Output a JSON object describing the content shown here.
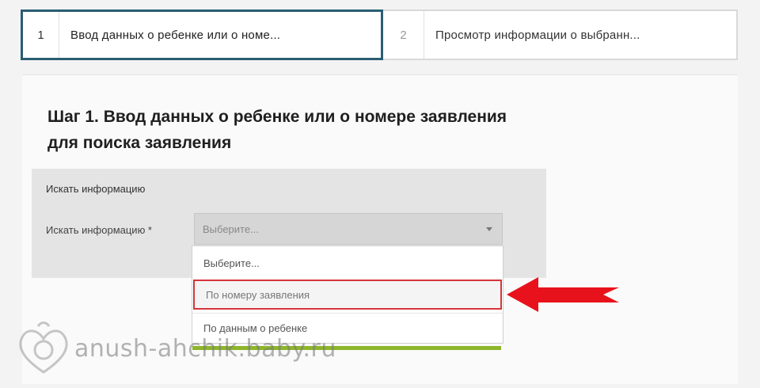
{
  "stepper": {
    "steps": [
      {
        "number": "1",
        "label": "Ввод данных о ребенке или о номе...",
        "active": true
      },
      {
        "number": "2",
        "label": "Просмотр информации о выбранн...",
        "active": false
      }
    ]
  },
  "main": {
    "heading": "Шаг 1. Ввод данных о ребенке или о номере заявления для поиска заявления",
    "search_box": {
      "title": "Искать информацию",
      "field_label": "Искать информацию *",
      "select_value": "Выберите...",
      "options": [
        "Выберите...",
        "По номеру заявления",
        "По данным о ребенке"
      ],
      "highlighted_option_index": 1
    }
  },
  "watermark": {
    "text": "anush-ahchik.baby.ru"
  },
  "colors": {
    "active_step_border": "#2a5d73",
    "highlight_border": "#d6343a",
    "arrow": "#e8121c",
    "underline": "#8db52a"
  },
  "icons": [
    "chevron-down-icon",
    "red-arrow-icon",
    "logo-icon"
  ]
}
